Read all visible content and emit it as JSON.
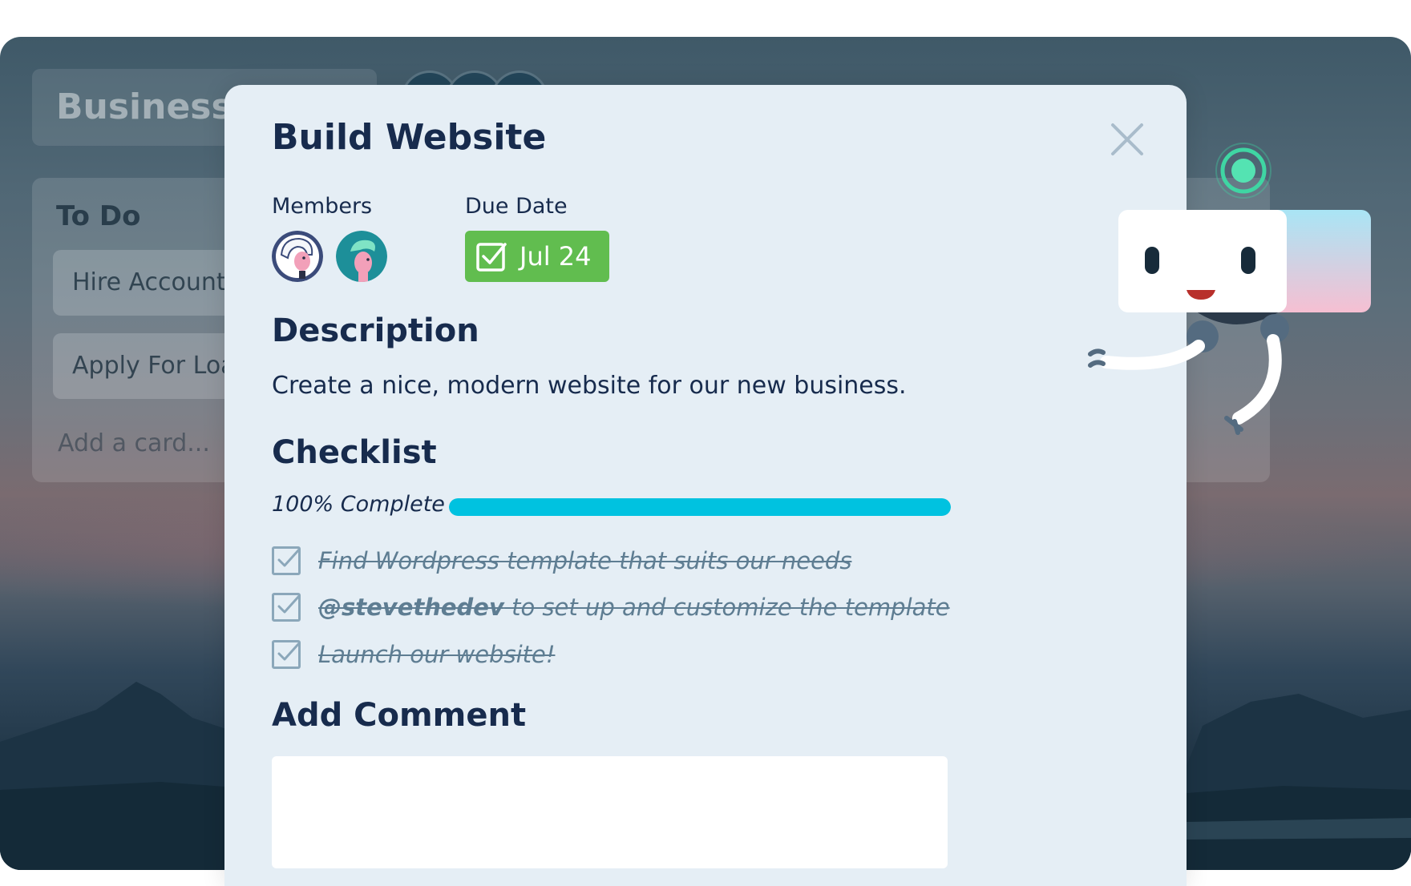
{
  "board": {
    "title": "Business",
    "list": {
      "title": "To Do",
      "cards": [
        "Hire Accountant",
        "Apply For Loan"
      ],
      "add_card": "Add a card..."
    }
  },
  "modal": {
    "title": "Build Website",
    "members_label": "Members",
    "due_label": "Due Date",
    "due_date": "Jul 24",
    "description_title": "Description",
    "description": "Create a nice, modern website for our new business.",
    "checklist_title": "Checklist",
    "progress_label": "100% Complete",
    "progress_fraction": 1.0,
    "checklist": [
      {
        "text": "Find Wordpress template that suits our needs",
        "done": true
      },
      {
        "mention": "@stevethedev",
        "text": " to set up and customize the template",
        "done": true
      },
      {
        "text": "Launch our website!",
        "done": true
      }
    ],
    "comment_title": "Add Comment",
    "comment_value": ""
  },
  "colors": {
    "due_badge": "#61bd4f",
    "progress": "#00c2e0",
    "heading_text": "#172b4d",
    "completed_text": "#5e7d92"
  },
  "icons": [
    "close-icon",
    "checkbox-checked-icon",
    "calendar-check-icon",
    "robot-mascot-illustration"
  ]
}
